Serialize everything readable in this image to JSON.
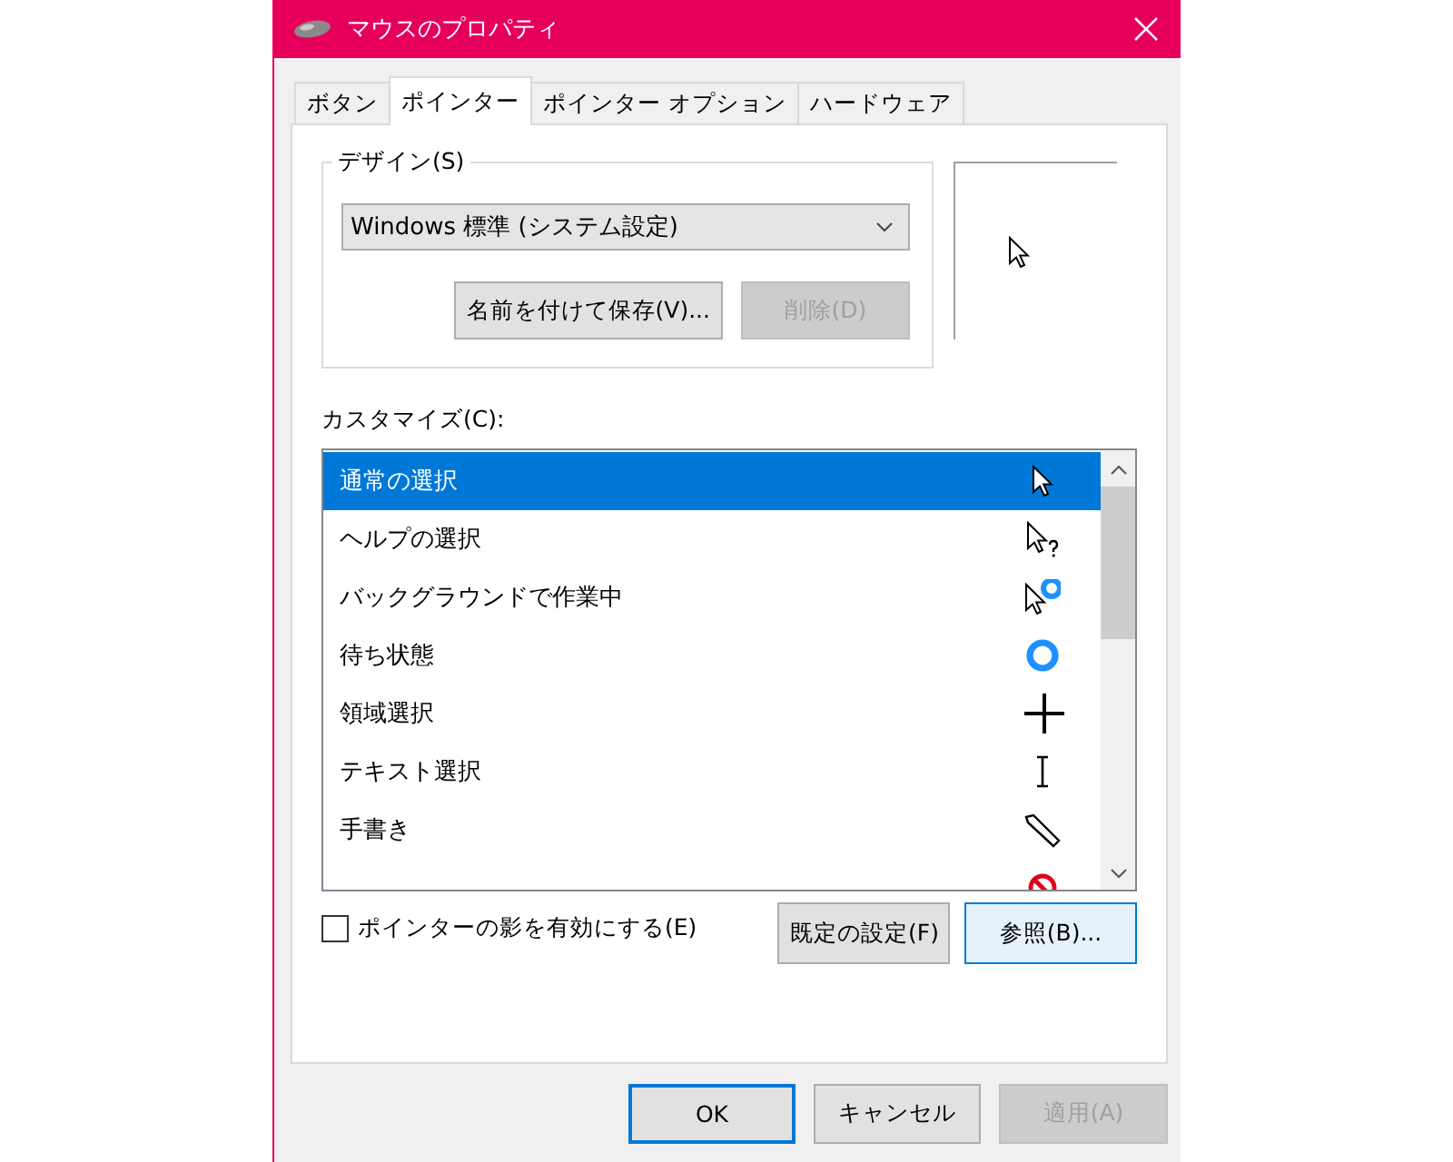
{
  "window": {
    "title": "マウスのプロパティ"
  },
  "tabs": [
    {
      "label": "ボタン",
      "selected": false
    },
    {
      "label": "ポインター",
      "selected": true
    },
    {
      "label": "ポインター オプション",
      "selected": false
    },
    {
      "label": "ハードウェア",
      "selected": false
    }
  ],
  "design": {
    "label": "デザイン(S)",
    "scheme": "Windows 標準 (システム設定)",
    "buttons": [
      {
        "label": "名前を付けて保存(V)...",
        "disabled": false
      },
      {
        "label": "削除(D)",
        "disabled": true
      }
    ]
  },
  "customize": {
    "label": "カスタマイズ(C):",
    "items": [
      {
        "label": "通常の選択",
        "kind": "arrow",
        "selected": true
      },
      {
        "label": "ヘルプの選択",
        "kind": "help",
        "selected": false
      },
      {
        "label": "バックグラウンドで作業中",
        "kind": "busy",
        "selected": false
      },
      {
        "label": "待ち状態",
        "kind": "wait",
        "selected": false
      },
      {
        "label": "領域選択",
        "kind": "cross",
        "selected": false
      },
      {
        "label": "テキスト選択",
        "kind": "text",
        "selected": false
      },
      {
        "label": "手書き",
        "kind": "pen",
        "selected": false
      },
      {
        "kind": "unavailable",
        "selected": false
      }
    ]
  },
  "shadow": {
    "label": "ポインターの影を有効にする(E)",
    "checked": false
  },
  "list_buttons": [
    {
      "label": "既定の設定(F)",
      "hovered": false
    },
    {
      "label": "参照(B)...",
      "hovered": true
    }
  ],
  "dialog_buttons": [
    {
      "label": "OK",
      "default": true,
      "disabled": false
    },
    {
      "label": "キャンセル",
      "default": false,
      "disabled": false
    },
    {
      "label": "適用(A)",
      "default": false,
      "disabled": true
    }
  ]
}
